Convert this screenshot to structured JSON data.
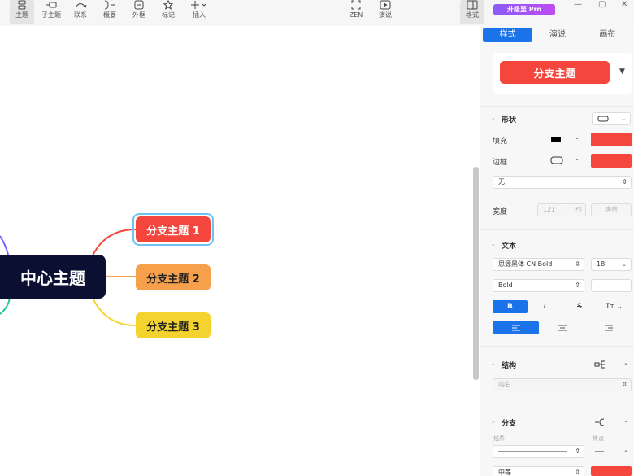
{
  "toolbar": {
    "items": [
      {
        "label": "主题",
        "icon": "topic-icon"
      },
      {
        "label": "子主题",
        "icon": "subtopic-icon"
      },
      {
        "label": "联系",
        "icon": "relationship-icon"
      },
      {
        "label": "概要",
        "icon": "summary-icon"
      },
      {
        "label": "外框",
        "icon": "boundary-icon"
      },
      {
        "label": "标记",
        "icon": "star-icon"
      },
      {
        "label": "插入",
        "icon": "plus-icon"
      },
      {
        "label": "ZEN",
        "icon": "zen-icon"
      },
      {
        "label": "演说",
        "icon": "play-icon"
      },
      {
        "label": "格式",
        "icon": "format-panel-icon"
      }
    ],
    "pro_badge": "升级至 Pro"
  },
  "mindmap": {
    "central": "中心主题",
    "branches": [
      "分支主题 1",
      "分支主题 2",
      "分支主题 3"
    ],
    "colors": {
      "central": "#0b1033",
      "branch1": "#f5463d",
      "branch2": "#f7a04b",
      "branch3": "#f5d32e",
      "selection": "#6ec3f2"
    }
  },
  "panel": {
    "tabs": [
      "样式",
      "演说",
      "画布"
    ],
    "style_preview": "分支主题",
    "shape": {
      "title": "形状",
      "fill_label": "填充",
      "border_label": "边框",
      "border_style": "无",
      "width_label": "宽度",
      "width_value": "121",
      "width_unit": "PX",
      "fit_button": "適合"
    },
    "text": {
      "title": "文本",
      "font": "思源黑体 CN Bold",
      "size": "18",
      "weight": "Bold",
      "bold": "B",
      "italic": "I",
      "strike": "S",
      "case": "Tт"
    },
    "structure": {
      "title": "结构",
      "direction": "向右"
    },
    "branch": {
      "title": "分支",
      "line_label": "线条",
      "end_label": "终点",
      "thickness": "中等"
    },
    "accent": "#1a73e8",
    "fill_color": "#f5463d"
  }
}
